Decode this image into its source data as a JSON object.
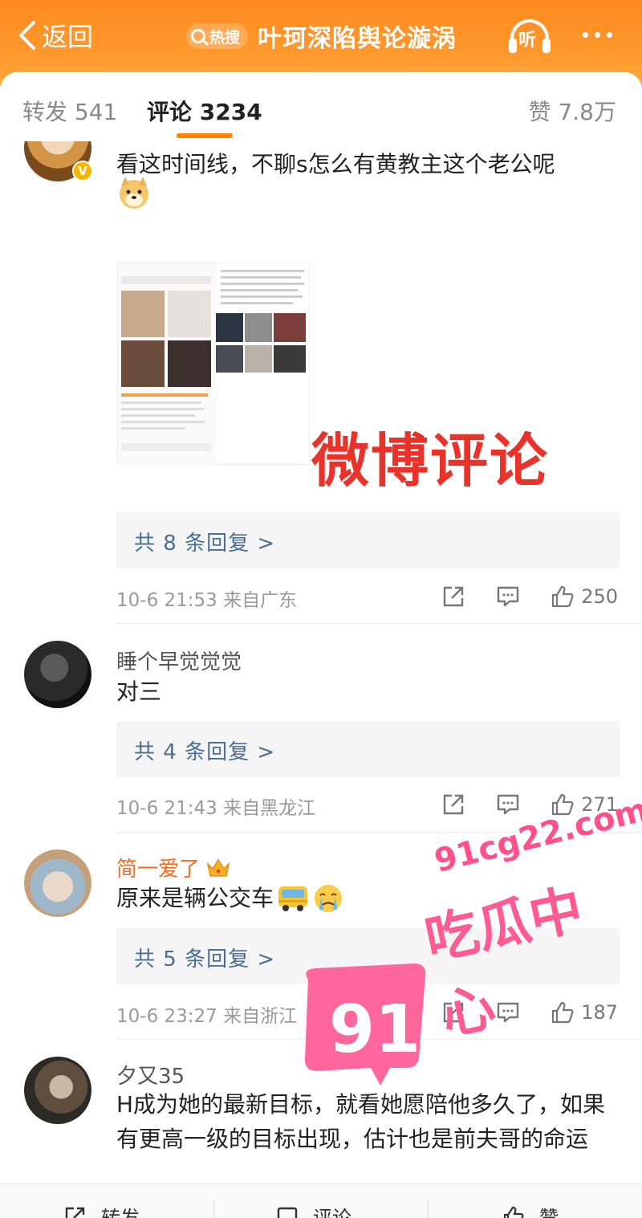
{
  "header": {
    "back_label": "返回",
    "hot_badge": "热搜",
    "title": "叶珂深陷舆论漩涡",
    "listen_label": "听"
  },
  "tabs": {
    "forward": "转发 541",
    "comment": "评论 3234",
    "likes": "赞 7.8万"
  },
  "comments": [
    {
      "text": "看这时间线，不聊s怎么有黄教主这个老公呢",
      "image_caption": "微博评论",
      "replies": "共 8 条回复 >",
      "meta": "10-6 21:53 来自广东",
      "like_count": "250"
    },
    {
      "username": "睡个早觉觉觉",
      "text": "对三",
      "replies": "共 4 条回复 >",
      "meta": "10-6 21:43 来自黑龙江",
      "like_count": "271"
    },
    {
      "username": "简一爱了",
      "text": "原来是辆公交车",
      "replies": "共 5 条回复 >",
      "meta": "10-6 23:27 来自浙江",
      "like_count": "187"
    },
    {
      "username": "夕又35",
      "text": "H成为她的最新目标，就看她愿陪他多久了，如果有更高一级的目标出现，估计也是前夫哥的命运"
    }
  ],
  "bottom_bar": {
    "forward": "转发",
    "comment": "评论",
    "like": "赞"
  },
  "watermark": {
    "url": "91cg22.com",
    "number": "91",
    "label": "吃瓜中心"
  },
  "colors": {
    "brand_orange": "#ff8200",
    "link_blue": "#4a6e94",
    "watermark_pink": "#ff5a94"
  }
}
